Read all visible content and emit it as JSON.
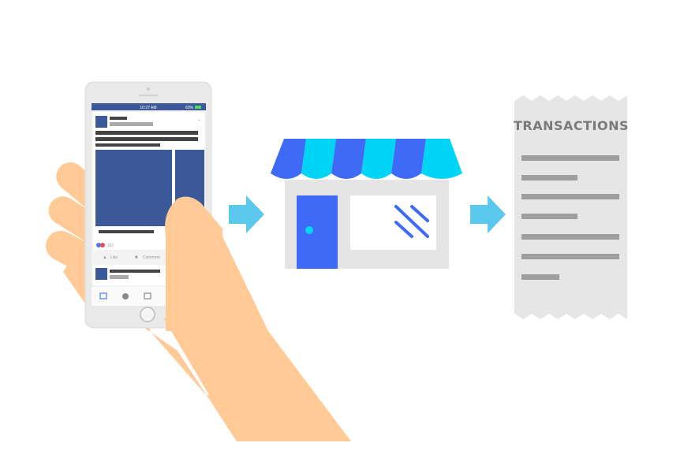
{
  "phone": {
    "status_time": "10:27 AM",
    "battery_percent": "63%",
    "reaction_count": "167",
    "action_like": "Like",
    "action_comment": "Comment"
  },
  "receipt": {
    "title": "TRANSACTIONS"
  },
  "colors": {
    "hand": "#FFCA96",
    "facebook_blue": "#3B5998",
    "store_blue": "#3E6AF5",
    "store_cyan": "#00D5F5",
    "arrow": "#5BC8EE",
    "receipt": "#E6E6E6",
    "receipt_lines": "#9E9E9E"
  },
  "icons": [
    "phone-icon",
    "hand-icon",
    "store-icon",
    "arrow-right-icon",
    "receipt-icon"
  ]
}
